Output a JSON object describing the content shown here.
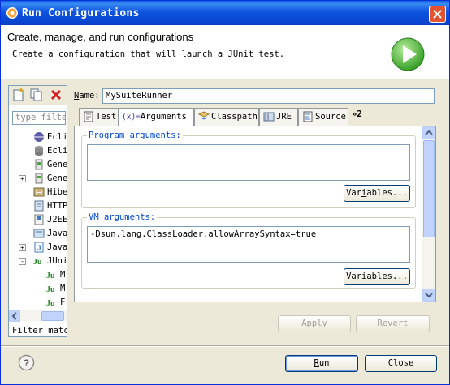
{
  "window": {
    "title": "Run Configurations"
  },
  "banner": {
    "title": "Create, manage, and run configurations",
    "description": "Create a configuration that will launch a JUnit test."
  },
  "left": {
    "filter_placeholder": "type filter",
    "tree": [
      {
        "label": "Ecli",
        "icon": "eclipse-app-icon"
      },
      {
        "label": "Ecli",
        "icon": "database-icon"
      },
      {
        "label": "Gene",
        "icon": "generic-launch-icon"
      },
      {
        "label": "Gene",
        "icon": "generic-launch-icon"
      },
      {
        "label": "Hibe",
        "icon": "hibernate-icon"
      },
      {
        "label": "HTTP",
        "icon": "http-icon"
      },
      {
        "label": "J2EE",
        "icon": "j2ee-icon"
      },
      {
        "label": "Java",
        "icon": "java-applet-icon"
      },
      {
        "label": "Java",
        "icon": "java-app-icon"
      },
      {
        "label": "JUnit",
        "icon": "junit-icon"
      },
      {
        "label": "M",
        "icon": "junit-icon"
      },
      {
        "label": "M",
        "icon": "junit-icon"
      },
      {
        "label": "F",
        "icon": "junit-icon"
      }
    ],
    "status": "Filter matched"
  },
  "name": {
    "label": "Name:",
    "value": "MySuiteRunner"
  },
  "tabs": [
    {
      "label": "Test",
      "icon": "test-tab-icon"
    },
    {
      "label": "Arguments",
      "icon": "arguments-icon",
      "icon_text": "(x)="
    },
    {
      "label": "Classpath",
      "icon": "classpath-icon"
    },
    {
      "label": "JRE",
      "icon": "jre-icon"
    },
    {
      "label": "Source",
      "icon": "source-icon"
    }
  ],
  "tabs_more": "»2",
  "program_args": {
    "label": "Program arguments:",
    "value": "",
    "variables_button": "Variables..."
  },
  "vm_args": {
    "label": "VM arguments:",
    "value": "-Dsun.lang.ClassLoader.allowArraySyntax=true",
    "variables_button": "Variables..."
  },
  "buttons": {
    "apply": "Apply",
    "revert": "Revert",
    "run": "Run",
    "close": "Close"
  },
  "colors": {
    "title_bar": "#0a5fe3",
    "run_icon": "#3fab2f",
    "group_label": "#0046d5"
  }
}
